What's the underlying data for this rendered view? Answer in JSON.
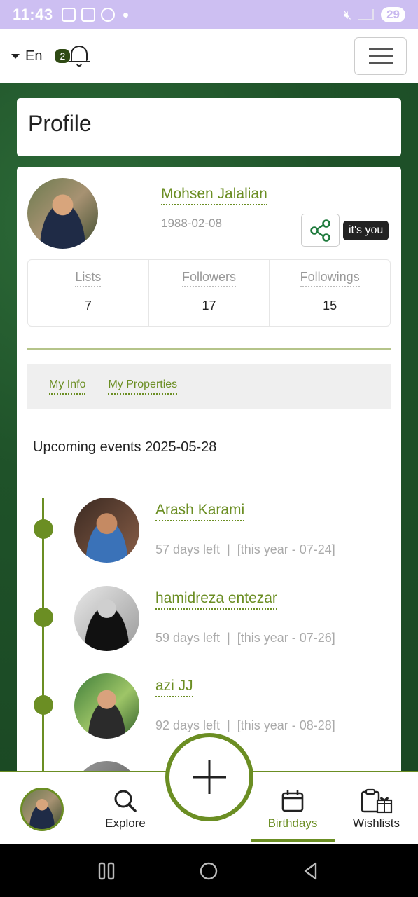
{
  "status_bar": {
    "time": "11:43",
    "battery": "29"
  },
  "header": {
    "language": "En",
    "notification_count": "2"
  },
  "page_title": "Profile",
  "profile": {
    "name": "Mohsen Jalalian",
    "birthdate": "1988-02-08",
    "self_tag": "it's you",
    "stats": [
      {
        "label": "Lists",
        "value": "7"
      },
      {
        "label": "Followers",
        "value": "17"
      },
      {
        "label": "Followings",
        "value": "15"
      }
    ]
  },
  "tabs": [
    {
      "label": "My Info"
    },
    {
      "label": "My Properties"
    }
  ],
  "events": {
    "title": "Upcoming events 2025-05-28",
    "items": [
      {
        "name": "Arash Karami",
        "days_left": "57 days left",
        "date": "[this year - 07-24]"
      },
      {
        "name": "hamidreza entezar",
        "days_left": "59 days left",
        "date": "[this year - 07-26]"
      },
      {
        "name": "azi JJ",
        "days_left": "92 days left",
        "date": "[this year - 08-28]"
      }
    ]
  },
  "bottom_nav": {
    "explore": "Explore",
    "birthdays": "Birthdays",
    "wishlists": "Wishlists"
  },
  "colors": {
    "accent": "#6b8e23",
    "background": "#1f5229",
    "status_bar": "#cdbff2"
  }
}
